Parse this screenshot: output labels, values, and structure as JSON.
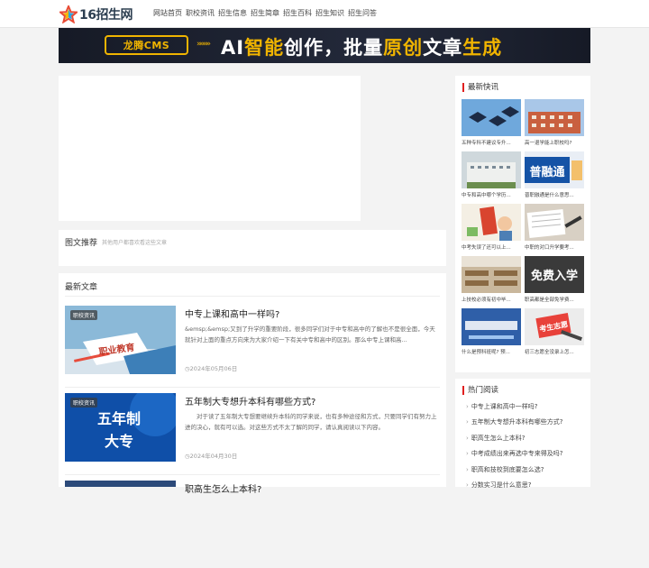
{
  "header": {
    "logo_text": "16招生网",
    "nav": [
      "网站首页",
      "职校资讯",
      "招生信息",
      "招生简章",
      "招生百科",
      "招生知识",
      "招生问答"
    ]
  },
  "banner": {
    "brand": "龙腾CMS",
    "arrows": "»»»»",
    "headline_a": "AI",
    "headline_b": "智能",
    "headline_c": "创作，批量",
    "headline_d": "原创",
    "headline_e": "文章",
    "headline_f": "生成"
  },
  "tuwen": {
    "title": "图文推荐",
    "subtitle": "其他用户都喜欢看这些文章"
  },
  "latest": {
    "title": "最新文章",
    "posts": [
      {
        "tag": "职校资讯",
        "title": "中专上课和高中一样吗?",
        "excerpt": "&emsp;&emsp;又到了升学的重要阶段，很多同学们对于中专和高中的了解也不是很全面，今天就针对上面的重点方向来为大家介绍一下有关中专和高中的区别。那么中专上课和高...",
        "date": "2024年05月06日",
        "thumb_text": "职业教育"
      },
      {
        "tag": "职校资讯",
        "title": "五年制大专想升本科有哪些方式?",
        "excerpt": "对于读了五年制大专想要继续升本科的同学来说，也有多种途径和方式，只要同学们有努力上进的决心，就有可以选。对这些方式不太了解的同学，请认真阅读以下内容。",
        "date": "2024年04月30日",
        "thumb_text_a": "五年制",
        "thumb_text_b": "大专"
      },
      {
        "title": "职高生怎么上本科?"
      }
    ]
  },
  "sidebar": {
    "title": "最新快讯",
    "items": [
      {
        "caption": "五种专科不建议专升..."
      },
      {
        "caption": "高一退学能上职校吗?"
      },
      {
        "caption": "中专和高中哪个学历..."
      },
      {
        "caption": "普职融通是什么意思...",
        "img_text": "普融通"
      },
      {
        "caption": "中考失误了还可以上..."
      },
      {
        "caption": "中职的对口升学要考..."
      },
      {
        "caption": "上技校必须有初中毕..."
      },
      {
        "caption": "职高都是全部免学费...",
        "img_text": "免费入学"
      },
      {
        "caption": "什么是预科班呢? 预..."
      },
      {
        "caption": "初三志愿全没录上怎...",
        "img_text": "考生志愿"
      }
    ]
  },
  "hot": {
    "title": "热门阅读",
    "items": [
      "中专上课和高中一样吗?",
      "五年制大专想升本科有哪些方式?",
      "职高生怎么上本科?",
      "中考成绩出来再选中专来得及吗?",
      "职高和技校到底要怎么选?",
      "分数实习是什么意思?"
    ]
  }
}
